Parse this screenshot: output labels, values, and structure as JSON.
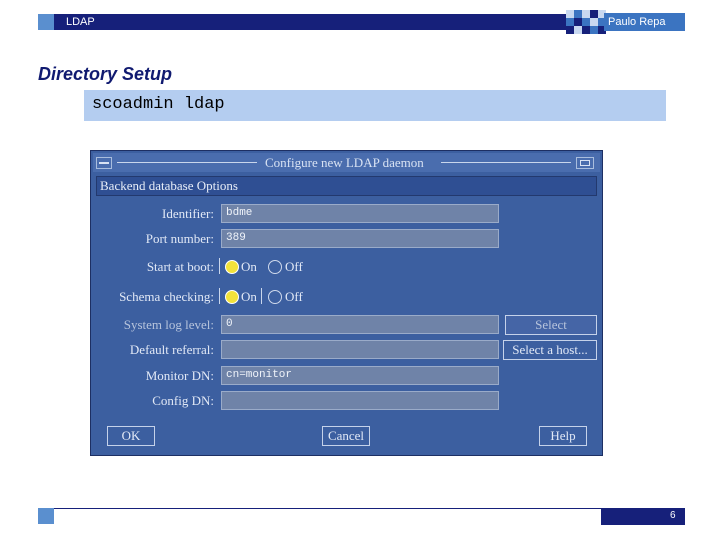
{
  "header": {
    "title": "LDAP",
    "author": "Paulo Repa",
    "colors": {
      "bar": "#16207a",
      "accent": "#5a8fcf",
      "author_box": "#3b74c1"
    }
  },
  "slide": {
    "heading": "Directory Setup",
    "command": "scoadmin ldap"
  },
  "dialog": {
    "title": "Configure new LDAP daemon",
    "section": "Backend database Options",
    "fields": {
      "identifier": {
        "label": "Identifier:",
        "value": "bdme"
      },
      "port": {
        "label": "Port number:",
        "value": "389"
      },
      "start_at_boot": {
        "label": "Start at boot:",
        "on": "On",
        "off": "Off",
        "selected": "On"
      },
      "schema_checking": {
        "label": "Schema checking:",
        "on": "On",
        "off": "Off",
        "selected": "On"
      },
      "syslog_level": {
        "label": "System log level:",
        "value": "0",
        "button": "Select"
      },
      "default_referral": {
        "label": "Default referral:",
        "value": "",
        "button": "Select a host..."
      },
      "monitor_dn": {
        "label": "Monitor DN:",
        "value": "cn=monitor"
      },
      "config_dn": {
        "label": "Config DN:",
        "value": ""
      }
    },
    "buttons": {
      "ok": "OK",
      "cancel": "Cancel",
      "help": "Help"
    },
    "colors": {
      "window": "#3c5fa0",
      "field": "#6f83a8",
      "radio_selected": "#f2e23b"
    }
  },
  "footer": {
    "page_number": "6"
  }
}
